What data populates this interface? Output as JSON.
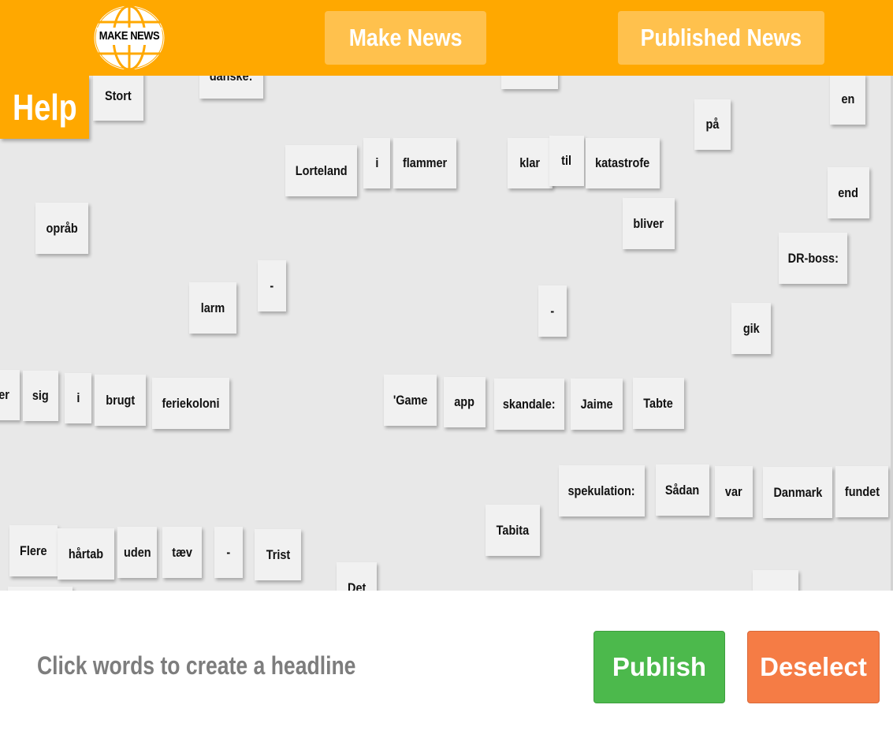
{
  "header": {
    "logo_text": "MAKE NEWS",
    "nav": {
      "make_news": "Make News",
      "published_news": "Published News"
    }
  },
  "help_label": "Help",
  "words": [
    {
      "text": "danske:"
    },
    {
      "text": ""
    },
    {
      "text": "Stort"
    },
    {
      "text": "en"
    },
    {
      "text": "på"
    },
    {
      "text": "Lorteland"
    },
    {
      "text": "i"
    },
    {
      "text": "flammer"
    },
    {
      "text": "klar"
    },
    {
      "text": "til"
    },
    {
      "text": "katastrofe"
    },
    {
      "text": "end"
    },
    {
      "text": "opråb"
    },
    {
      "text": "bliver"
    },
    {
      "text": "DR-boss:"
    },
    {
      "text": "-"
    },
    {
      "text": "larm"
    },
    {
      "text": "-"
    },
    {
      "text": "gik"
    },
    {
      "text": "er"
    },
    {
      "text": "sig"
    },
    {
      "text": "i"
    },
    {
      "text": "brugt"
    },
    {
      "text": "feriekoloni"
    },
    {
      "text": "'Game"
    },
    {
      "text": "app"
    },
    {
      "text": "skandale:"
    },
    {
      "text": "Jaime"
    },
    {
      "text": "Tabte"
    },
    {
      "text": "spekulation:"
    },
    {
      "text": "Sådan"
    },
    {
      "text": "var"
    },
    {
      "text": "Danmark"
    },
    {
      "text": "fundet"
    },
    {
      "text": "Tabita"
    },
    {
      "text": "Flere"
    },
    {
      "text": "hårtab"
    },
    {
      "text": "uden"
    },
    {
      "text": "tæv"
    },
    {
      "text": "-"
    },
    {
      "text": "Trist"
    },
    {
      "text": "Det"
    },
    {
      "text": ""
    },
    {
      "text": ""
    }
  ],
  "footer": {
    "instruction": "Click words to create a headline",
    "publish": "Publish",
    "deselect": "Deselect"
  },
  "colors": {
    "header": "#ffa800",
    "nav_button": "#ffc14d",
    "board": "#e8e8e8",
    "tile": "#f1f1f1",
    "publish": "#4cb94c",
    "deselect": "#f57c45",
    "instruction": "#7d7d7d"
  }
}
